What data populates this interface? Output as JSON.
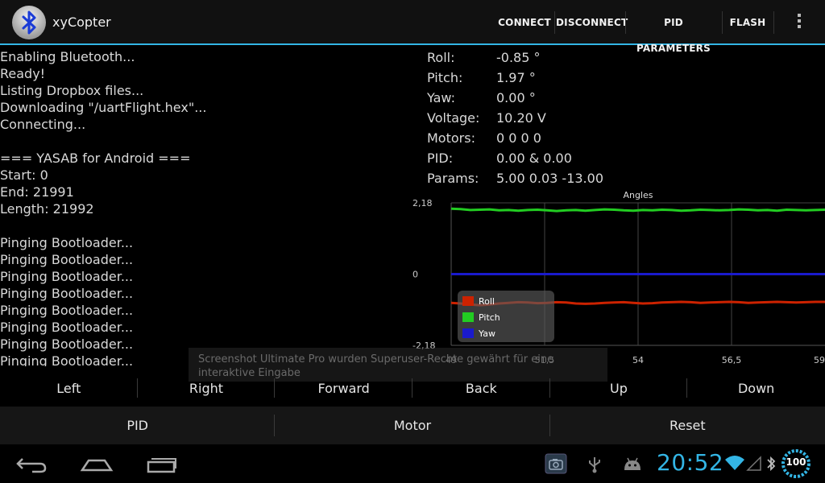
{
  "app": {
    "title": "xyCopter"
  },
  "actionbar": {
    "buttons": [
      "CONNECT",
      "DISCONNECT",
      "PID PARAMETERS",
      "FLASH"
    ]
  },
  "log": [
    "Enabling Bluetooth...",
    "Ready!",
    "Listing Dropbox files...",
    "Downloading \"/uartFlight.hex\"...",
    "Connecting...",
    "",
    "=== YASAB for Android ===",
    "Start: 0",
    "End: 21991",
    "Length: 21992",
    "",
    "Pinging Bootloader...",
    "Pinging Bootloader...",
    "Pinging Bootloader...",
    "Pinging Bootloader...",
    "Pinging Bootloader...",
    "Pinging Bootloader...",
    "Pinging Bootloader...",
    "Pinging Bootloader..."
  ],
  "telemetry": [
    {
      "label": "Roll:",
      "value": "-0.85 °"
    },
    {
      "label": "Pitch:",
      "value": "1.97 °"
    },
    {
      "label": "Yaw:",
      "value": "0.00 °"
    },
    {
      "label": "Voltage:",
      "value": "10.20 V"
    },
    {
      "label": "Motors:",
      "value": "0 0 0 0"
    },
    {
      "label": "PID:",
      "value": "0.00 & 0.00"
    },
    {
      "label": "Params:",
      "value": "5.00 0.03 -13.00"
    }
  ],
  "chart_data": {
    "type": "line",
    "title": "Angles",
    "x_ticks": [
      "49",
      "51,5",
      "54",
      "56,5",
      "59"
    ],
    "y_ticks": [
      "2,18",
      "0",
      "-2,18"
    ],
    "xlim": [
      49,
      59
    ],
    "ylim": [
      -2.18,
      2.18
    ],
    "grid": true,
    "legend_position": "bottom-left",
    "series": [
      {
        "name": "Roll",
        "color": "#cc2200",
        "values": [
          -0.88,
          -0.9,
          -0.93,
          -0.95,
          -0.93,
          -0.9,
          -0.88,
          -0.86,
          -0.87,
          -0.89,
          -0.88,
          -0.86,
          -0.87,
          -0.9,
          -0.91,
          -0.9,
          -0.88,
          -0.87,
          -0.86,
          -0.88,
          -0.9,
          -0.89,
          -0.87,
          -0.86,
          -0.85,
          -0.86,
          -0.88,
          -0.87,
          -0.86,
          -0.85,
          -0.86,
          -0.88,
          -0.87,
          -0.86,
          -0.85,
          -0.86,
          -0.87,
          -0.86,
          -0.85,
          -0.85
        ]
      },
      {
        "name": "Pitch",
        "color": "#22cc22",
        "values": [
          2.0,
          1.99,
          1.96,
          1.97,
          1.98,
          1.95,
          1.96,
          1.94,
          1.96,
          1.97,
          1.95,
          1.93,
          1.95,
          1.96,
          1.94,
          1.96,
          1.98,
          1.97,
          1.95,
          1.94,
          1.96,
          1.95,
          1.97,
          1.96,
          1.94,
          1.95,
          1.97,
          1.96,
          1.95,
          1.96,
          1.98,
          1.97,
          1.95,
          1.96,
          1.94,
          1.97,
          1.96,
          1.95,
          1.96,
          1.97
        ]
      },
      {
        "name": "Yaw",
        "color": "#1a1acc",
        "values": [
          0,
          0,
          0,
          0,
          0,
          0,
          0,
          0,
          0,
          0,
          0,
          0,
          0,
          0,
          0,
          0,
          0,
          0,
          0,
          0,
          0,
          0,
          0,
          0,
          0,
          0,
          0,
          0,
          0,
          0,
          0,
          0,
          0,
          0,
          0,
          0,
          0,
          0,
          0,
          0
        ]
      }
    ]
  },
  "toast": "Screenshot Ultimate Pro wurden Superuser-Rechte gewährt für eine interaktive Eingabe",
  "controls": {
    "row1": [
      "Left",
      "Right",
      "Forward",
      "Back",
      "Up",
      "Down"
    ],
    "row2": [
      "PID",
      "Motor",
      "Reset"
    ]
  },
  "statusbar": {
    "clock": "20:52",
    "battery": "100"
  }
}
